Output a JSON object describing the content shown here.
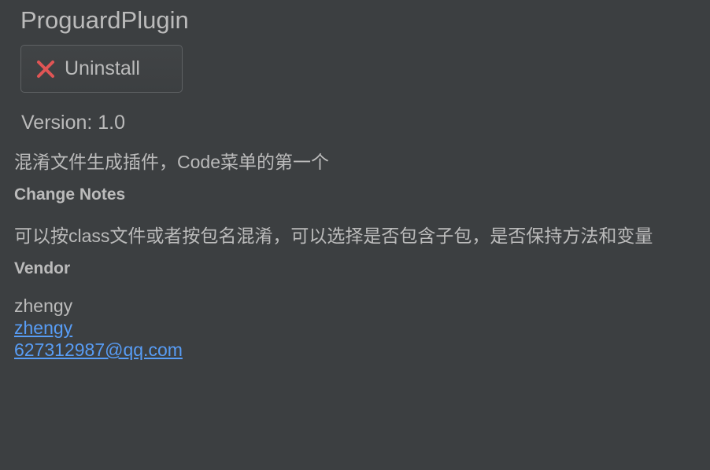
{
  "plugin": {
    "title": "ProguardPlugin",
    "uninstall_label": "Uninstall",
    "version": "Version: 1.0",
    "description": "混淆文件生成插件，Code菜单的第一个"
  },
  "change_notes": {
    "heading": "Change Notes",
    "text": "可以按class文件或者按包名混淆，可以选择是否包含子包，是否保持方法和变量"
  },
  "vendor": {
    "heading": "Vendor",
    "name": "zhengy",
    "url_text": "zhengy",
    "email": "627312987@qq.com"
  },
  "icons": {
    "uninstall": "close-x-icon"
  },
  "colors": {
    "background": "#3c3f41",
    "text": "#bbbbbb",
    "link": "#589df6",
    "uninstall_icon": "#e05555"
  }
}
